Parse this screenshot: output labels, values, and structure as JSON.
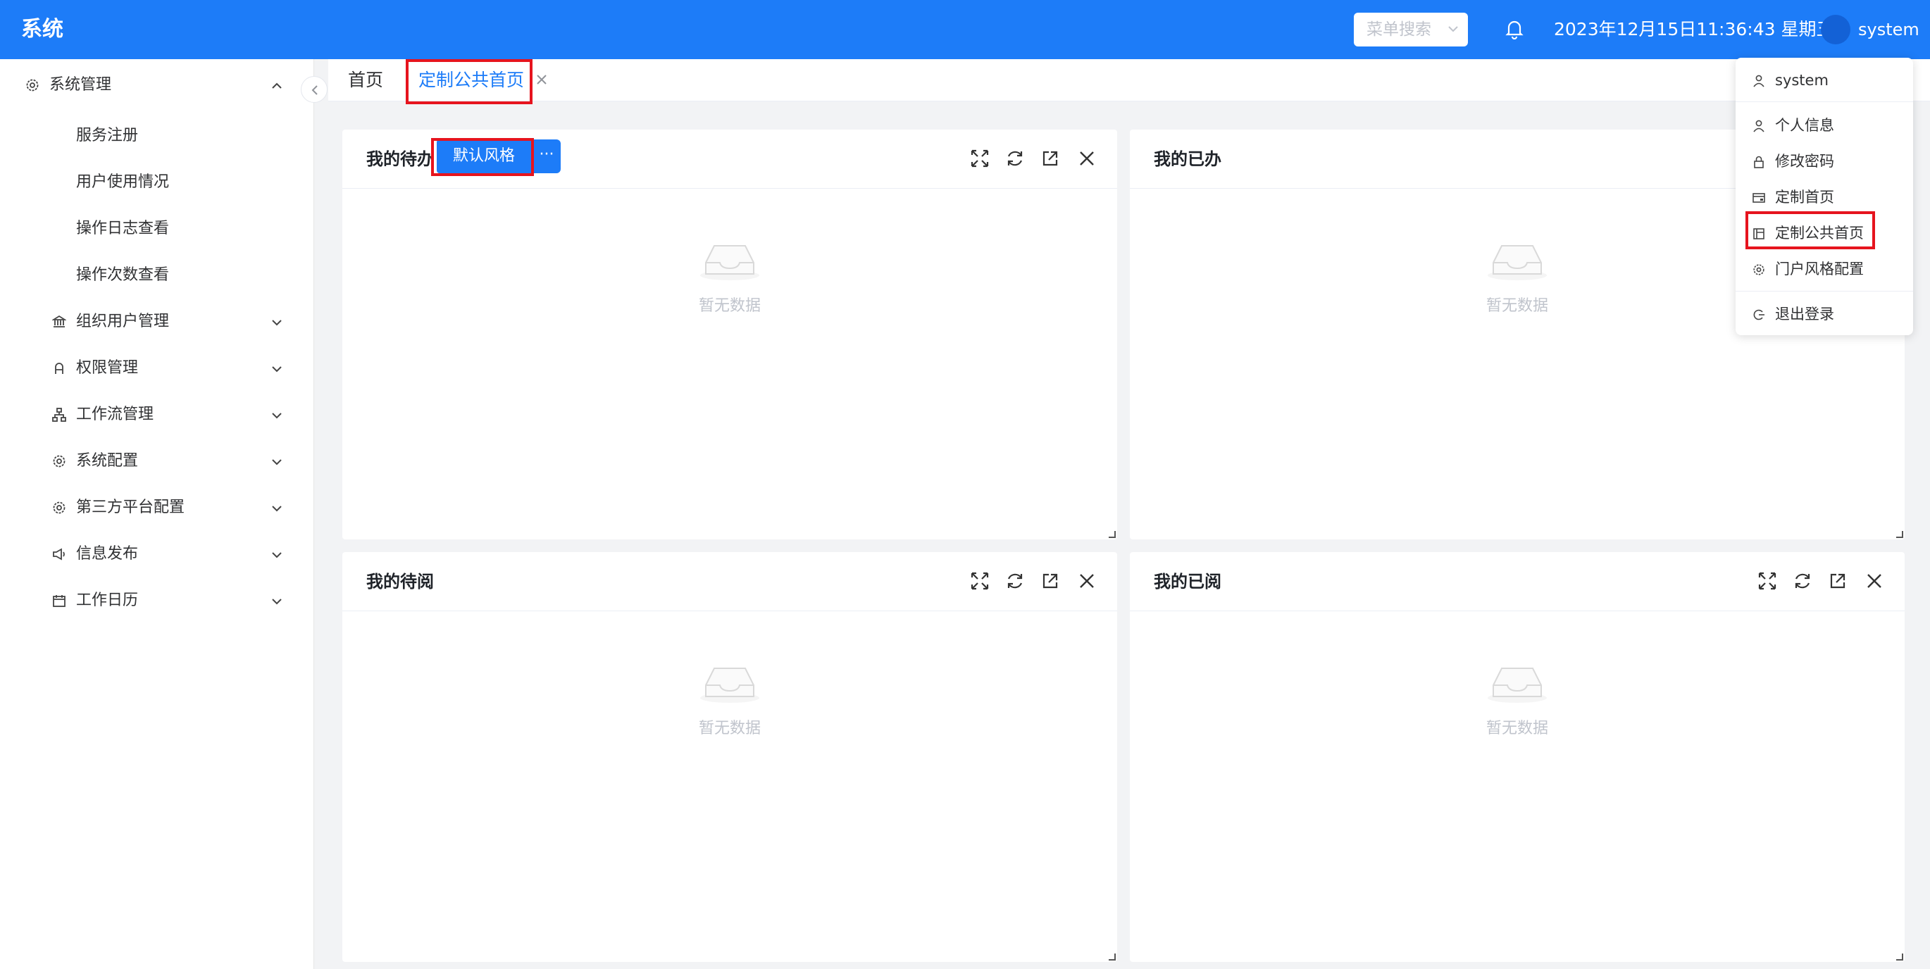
{
  "header": {
    "app_title": "系统",
    "search_placeholder": "菜单搜索",
    "datetime": "2023年12月15日11:36:43 星期五",
    "username": "system"
  },
  "sidebar": {
    "section": {
      "label": "系统管理",
      "icon": "gear-icon",
      "expanded": true
    },
    "sub_items": [
      "服务注册",
      "用户使用情况",
      "操作日志查看",
      "操作次数查看"
    ],
    "groups": [
      {
        "label": "组织用户管理",
        "icon": "bank-icon"
      },
      {
        "label": "权限管理",
        "icon": "user-key-icon"
      },
      {
        "label": "工作流管理",
        "icon": "flow-icon"
      },
      {
        "label": "系统配置",
        "icon": "gear-icon"
      },
      {
        "label": "第三方平台配置",
        "icon": "gear-icon"
      },
      {
        "label": "信息发布",
        "icon": "megaphone-icon"
      },
      {
        "label": "工作日历",
        "icon": "calendar-icon"
      }
    ]
  },
  "tabs": [
    {
      "label": "首页",
      "active": false
    },
    {
      "label": "定制公共首页",
      "active": true
    }
  ],
  "cards": [
    {
      "title": "我的待办",
      "empty_text": "暂无数据"
    },
    {
      "title": "我的已办",
      "empty_text": "暂无数据"
    },
    {
      "title": "我的待阅",
      "empty_text": "暂无数据"
    },
    {
      "title": "我的已阅",
      "empty_text": "暂无数据"
    }
  ],
  "style_button": {
    "label": "默认风格",
    "more": "···"
  },
  "user_menu": {
    "items": [
      {
        "label": "system",
        "icon": "user-icon"
      },
      {
        "label": "个人信息",
        "icon": "person-icon"
      },
      {
        "label": "修改密码",
        "icon": "lock-icon"
      },
      {
        "label": "定制首页",
        "icon": "card-icon"
      },
      {
        "label": "定制公共首页",
        "icon": "layout-icon"
      },
      {
        "label": "门户风格配置",
        "icon": "gear-icon"
      },
      {
        "label": "退出登录",
        "icon": "logout-icon"
      }
    ]
  },
  "colors": {
    "primary": "#1d7cf8",
    "highlight": "#e6141e",
    "background": "#f2f3f5"
  }
}
